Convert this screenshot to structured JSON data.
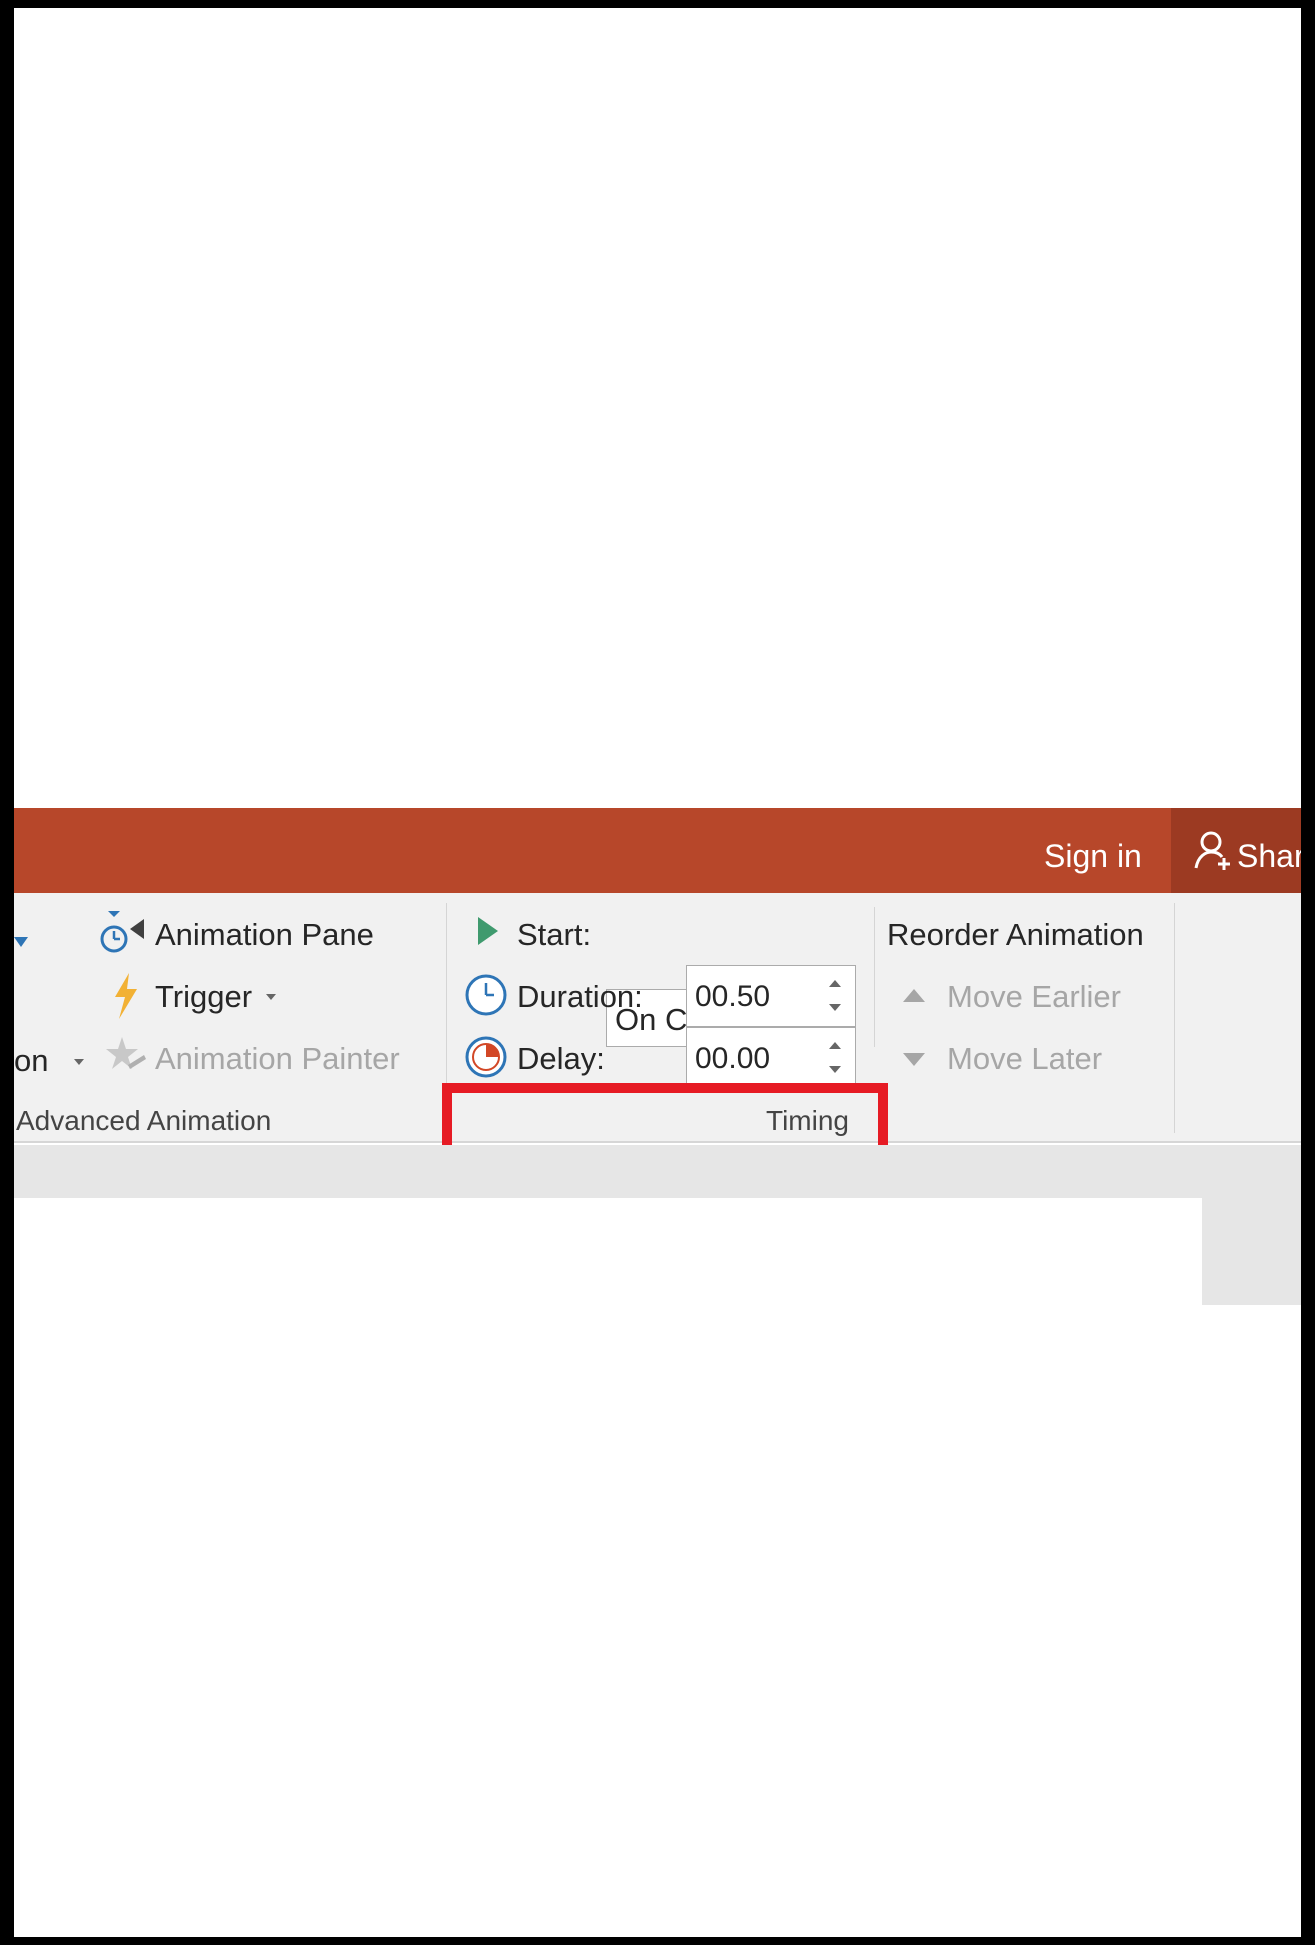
{
  "titlebar": {
    "signin": "Sign in",
    "share": "Shar",
    "bg": "#b7472a"
  },
  "advanced_animation": {
    "animation_pane": "Animation Pane",
    "trigger": "Trigger",
    "add_animation_partial": "on",
    "animation_painter": "Animation Painter",
    "group_label": "Advanced Animation"
  },
  "timing": {
    "start_label": "Start:",
    "start_value": "On Click",
    "duration_label": "Duration:",
    "duration_value": "00.50",
    "delay_label": "Delay:",
    "delay_value": "00.00",
    "group_label": "Timing"
  },
  "reorder": {
    "title": "Reorder Animation",
    "move_earlier": "Move Earlier",
    "move_later": "Move Later"
  },
  "highlight_color": "#e61b24"
}
